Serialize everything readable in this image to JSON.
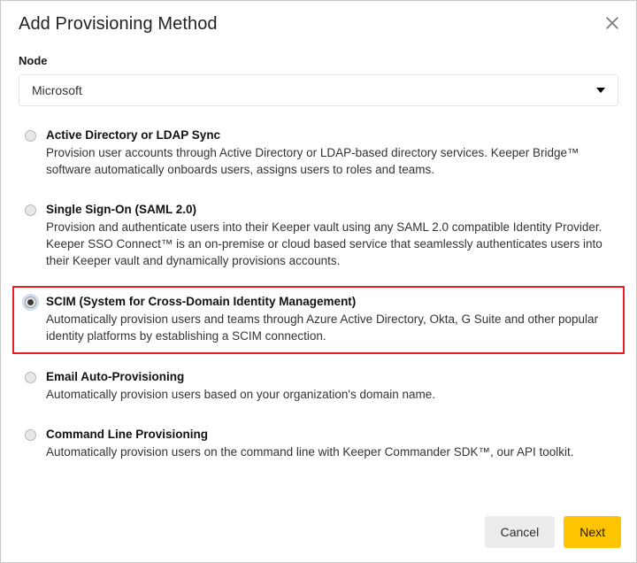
{
  "dialog": {
    "title": "Add Provisioning Method",
    "close_icon": "close-icon"
  },
  "node_field": {
    "label": "Node",
    "selected_value": "Microsoft",
    "caret_icon": "chevron-down-icon"
  },
  "options": [
    {
      "title": "Active Directory or LDAP Sync",
      "description": "Provision user accounts through Active Directory or LDAP-based directory services. Keeper Bridge™ software automatically onboards users, assigns users to roles and teams.",
      "selected": false,
      "highlighted": false
    },
    {
      "title": "Single Sign-On (SAML 2.0)",
      "description": "Provision and authenticate users into their Keeper vault using any SAML 2.0 compatible Identity Provider. Keeper SSO Connect™ is an on-premise or cloud based service that seamlessly authenticates users into their Keeper vault and dynamically provisions accounts.",
      "selected": false,
      "highlighted": false
    },
    {
      "title": "SCIM (System for Cross-Domain Identity Management)",
      "description": "Automatically provision users and teams through Azure Active Directory, Okta, G Suite and other popular identity platforms by establishing a SCIM connection.",
      "selected": true,
      "highlighted": true
    },
    {
      "title": "Email Auto-Provisioning",
      "description": "Automatically provision users based on your organization's domain name.",
      "selected": false,
      "highlighted": false
    },
    {
      "title": "Command Line Provisioning",
      "description": "Automatically provision users on the command line with Keeper Commander SDK™, our API toolkit.",
      "selected": false,
      "highlighted": false
    }
  ],
  "footer": {
    "cancel_label": "Cancel",
    "next_label": "Next"
  },
  "colors": {
    "highlight_border": "#ed1c24",
    "primary_button": "#ffc400",
    "secondary_button": "#ececec",
    "dialog_border": "#c8c8c8"
  }
}
